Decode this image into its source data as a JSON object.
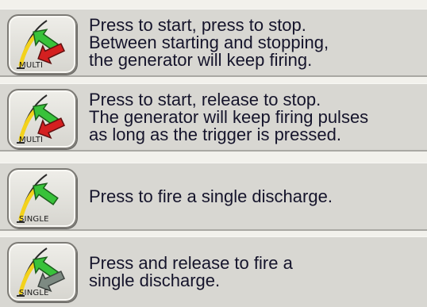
{
  "modes": [
    {
      "button_label": "MULTI",
      "icon": "handpiece-arrow-green-red-icon",
      "description": [
        "Press to start, press to stop.",
        "Between starting and stopping,",
        "the generator will keep firing."
      ]
    },
    {
      "button_label": "MULTI",
      "icon": "handpiece-arrow-green-red-icon",
      "description": [
        "Press to start, release to stop.",
        "The generator will keep firing pulses",
        "as long as the trigger is pressed."
      ]
    },
    {
      "button_label": "SINGLE",
      "icon": "handpiece-arrow-green-icon",
      "description": [
        "Press to fire a single discharge."
      ]
    },
    {
      "button_label": "SINGLE",
      "icon": "handpiece-arrow-green-gray-icon",
      "description": [
        "Press and release to fire a",
        "single discharge."
      ]
    }
  ],
  "colors": {
    "arrow_green": "#38c23a",
    "arrow_red": "#d42020",
    "arrow_gray": "#7d8a82",
    "handpiece_yellow": "#f3d21c",
    "text": "#15142b"
  }
}
